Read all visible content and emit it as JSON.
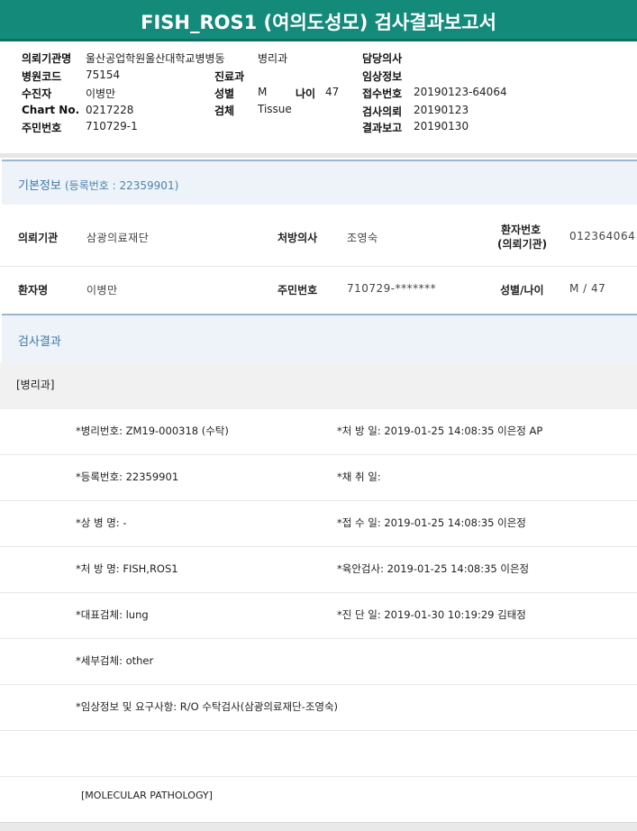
{
  "title": "FISH_ROS1 (여의도성모) 검사결과보고서",
  "header": {
    "req_inst_label": "의뢰기관명",
    "req_inst_value": "울산공업학원울산대학교병병동",
    "dept_value": "병리과",
    "hosp_code_label": "병원코드",
    "hosp_code_value": "75154",
    "collector_label": "수진자",
    "collector_value": "이병만",
    "chart_label": "Chart No.",
    "chart_value": "0217228",
    "rrn_label": "주민번호",
    "rrn_value": "710729-1",
    "dept_label": "진료과",
    "sex_label": "성별",
    "sex_value": "M",
    "age_label": "나이",
    "age_value": "47",
    "specimen_label": "검체",
    "specimen_value": "Tissue",
    "doctor_label": "담당의사",
    "clinical_label": "임상정보",
    "receipt_label": "접수번호",
    "receipt_value": "20190123-64064",
    "req_date_label": "검사의뢰",
    "req_date_value": "20190123",
    "report_label": "결과보고",
    "report_value": "20190130"
  },
  "basic": {
    "title": "기본정보",
    "sub": "(등록번호 : 22359901)",
    "inst_label": "의뢰기관",
    "inst_value": "삼광의료재단",
    "presc_label": "처방의사",
    "presc_value": "조영숙",
    "pid_label_1": "환자번호",
    "pid_label_2": "(의뢰기관)",
    "pid_value": "012364064",
    "name_label": "환자명",
    "name_value": "이병만",
    "rrn_label": "주민번호",
    "rrn_value": "710729-*******",
    "sexage_label": "성별/나이",
    "sexage_value": "M / 47"
  },
  "results": {
    "title": "검사결과",
    "dept": "[병리과]",
    "rows": [
      {
        "left": "*병리번호: ZM19-000318 (수탁)",
        "right": "*처 방 일: 2019-01-25 14:08:35  이은정 AP"
      },
      {
        "left": "*등록번호: 22359901",
        "right": "*채 취 일:"
      },
      {
        "left": "*상 병 명: -",
        "right": "*접 수 일: 2019-01-25 14:08:35  이은정"
      },
      {
        "left": "*처 방 명: FISH,ROS1",
        "right": "*육안검사: 2019-01-25 14:08:35  이은정"
      },
      {
        "left": "*대표검체: lung",
        "right": "*진 단 일: 2019-01-30 10:19:29  김태정"
      },
      {
        "left": "*세부검체: other",
        "right": ""
      },
      {
        "left": "*임상정보 및 요구사항: R/O 수탁검사(삼광의료재단-조영숙)",
        "right": ""
      },
      {
        "left": "",
        "right": ""
      }
    ],
    "molecular": "[MOLECULAR PATHOLOGY]"
  },
  "colors": {
    "title_bar": "#138a7a",
    "section_band": "#edf3f8",
    "section_text": "#3c78a8"
  }
}
